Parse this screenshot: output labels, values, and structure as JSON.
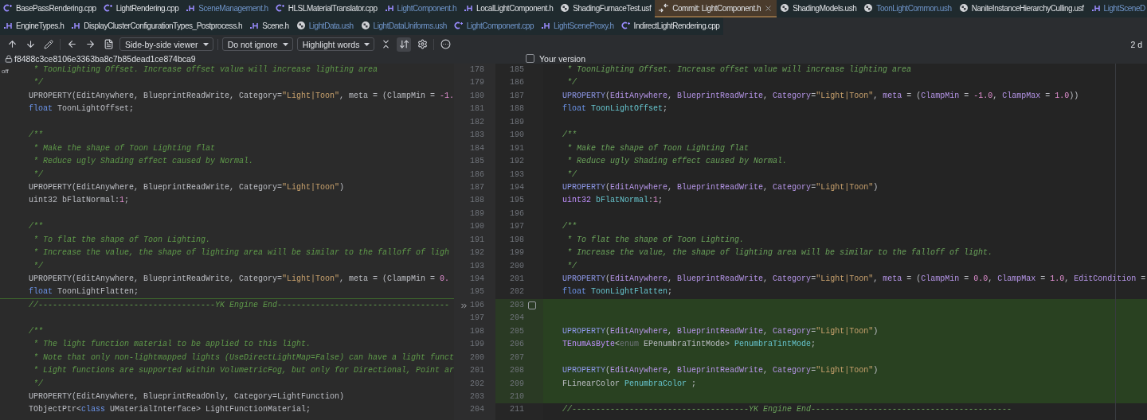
{
  "tab_rows": [
    [
      {
        "label": "BasePassRendering.cpp",
        "kind": "cpp",
        "modified": false,
        "selected": false
      },
      {
        "label": "LightRendering.cpp",
        "kind": "cpp",
        "modified": false,
        "selected": false
      },
      {
        "label": "SceneManagement.h",
        "kind": "h",
        "modified": true,
        "selected": false
      },
      {
        "label": "HLSLMaterialTranslator.cpp",
        "kind": "cpp",
        "modified": false,
        "selected": false
      },
      {
        "label": "LightComponent.h",
        "kind": "h",
        "modified": true,
        "selected": false
      },
      {
        "label": "LocalLightComponent.h",
        "kind": "h",
        "modified": false,
        "selected": false
      },
      {
        "label": "ShadingFurnaceTest.usf",
        "kind": "shader",
        "modified": false,
        "selected": false
      },
      {
        "label": "Commit: LightComponent.h",
        "kind": "commit",
        "modified": false,
        "selected": true
      },
      {
        "label": "ShadingModels.ush",
        "kind": "shader",
        "modified": false,
        "selected": false
      },
      {
        "label": "ToonLightCommon.ush",
        "kind": "shader",
        "modified": true,
        "selected": false
      },
      {
        "label": "NaniteInstanceHierarchyCulling.usf",
        "kind": "shader",
        "modified": false,
        "selected": false
      },
      {
        "label": "LightSceneD",
        "kind": "h",
        "modified": true,
        "selected": false
      }
    ],
    [
      {
        "label": "EngineTypes.h",
        "kind": "h",
        "modified": false,
        "selected": false
      },
      {
        "label": "DisplayClusterConfigurationTypes_Postprocess.h",
        "kind": "h",
        "modified": false,
        "selected": false
      },
      {
        "label": "Scene.h",
        "kind": "h",
        "modified": false,
        "selected": false
      },
      {
        "label": "LightData.ush",
        "kind": "shader",
        "modified": true,
        "selected": false
      },
      {
        "label": "LightDataUniforms.ush",
        "kind": "shader",
        "modified": true,
        "selected": false
      },
      {
        "label": "LightComponent.cpp",
        "kind": "cpp",
        "modified": true,
        "selected": false
      },
      {
        "label": "LightSceneProxy.h",
        "kind": "h",
        "modified": true,
        "selected": false
      },
      {
        "label": "IndirectLightRendering.cpp",
        "kind": "cpp",
        "modified": false,
        "selected": false
      }
    ]
  ],
  "toolbar": {
    "viewer": "Side-by-side viewer",
    "ignore": "Do not ignore",
    "highlight": "Highlight words",
    "sync_scroll": {
      "selected": true
    },
    "differences": "2 d"
  },
  "revision": "f8488c3ce8106e3363ba8c7b85dead1ce874bca9",
  "your_version": {
    "label": "Your version",
    "checked": false
  },
  "gutter_note": "off",
  "rows": [
    {
      "left_num": "178",
      "right_num": "185",
      "added": false,
      "left": [
        {
          "text": " * ToonLighting Offset. Increase offset value will increase lighting area",
          "kind": "comment"
        }
      ],
      "right": [
        {
          "text": " * ToonLighting Offset. Increase offset value will increase lighting area",
          "kind": "comment"
        }
      ]
    },
    {
      "left_num": "179",
      "right_num": "186",
      "added": false,
      "left": [
        {
          "text": " */",
          "kind": "comment"
        }
      ],
      "right": [
        {
          "text": " */",
          "kind": "comment"
        }
      ]
    },
    {
      "left_num": "180",
      "right_num": "187",
      "added": false,
      "left": [
        {
          "text": "UPROPERTY(EditAnywhere, BlueprintReadWrite, Category=",
          "kind": "plain"
        },
        {
          "text": "\"Light|Toon\"",
          "kind": "string"
        },
        {
          "text": ", meta = (ClampMin = ",
          "kind": "plain"
        },
        {
          "text": "-1.",
          "kind": "number"
        }
      ],
      "right": [
        {
          "text": "UPROPERTY",
          "kind": "macro"
        },
        {
          "text": "(",
          "kind": "plain"
        },
        {
          "text": "EditAnywhere",
          "kind": "attribute"
        },
        {
          "text": ", ",
          "kind": "plain"
        },
        {
          "text": "BlueprintReadWrite",
          "kind": "attribute"
        },
        {
          "text": ", ",
          "kind": "plain"
        },
        {
          "text": "Category",
          "kind": "attribute"
        },
        {
          "text": "=",
          "kind": "plain"
        },
        {
          "text": "\"Light|Toon\"",
          "kind": "string"
        },
        {
          "text": ", ",
          "kind": "plain"
        },
        {
          "text": "meta",
          "kind": "attribute"
        },
        {
          "text": " = (",
          "kind": "plain"
        },
        {
          "text": "ClampMin",
          "kind": "attribute"
        },
        {
          "text": " = ",
          "kind": "plain"
        },
        {
          "text": "-1.0",
          "kind": "number"
        },
        {
          "text": ", ",
          "kind": "plain"
        },
        {
          "text": "ClampMax",
          "kind": "attribute"
        },
        {
          "text": " = ",
          "kind": "plain"
        },
        {
          "text": "1.0",
          "kind": "number"
        },
        {
          "text": "))",
          "kind": "plain"
        }
      ]
    },
    {
      "left_num": "181",
      "right_num": "188",
      "added": false,
      "left": [
        {
          "text": "float ",
          "kind": "keyword"
        },
        {
          "text": "ToonLightOffset;",
          "kind": "plain"
        }
      ],
      "right": [
        {
          "text": "float ",
          "kind": "keyword"
        },
        {
          "text": "ToonLightOffset",
          "kind": "field"
        },
        {
          "text": ";",
          "kind": "plain"
        }
      ]
    },
    {
      "left_num": "182",
      "right_num": "189",
      "added": false,
      "left": [],
      "right": []
    },
    {
      "left_num": "183",
      "right_num": "190",
      "added": false,
      "left": [
        {
          "text": "/**",
          "kind": "comment"
        }
      ],
      "right": [
        {
          "text": "/**",
          "kind": "comment"
        }
      ]
    },
    {
      "left_num": "184",
      "right_num": "191",
      "added": false,
      "left": [
        {
          "text": " * Make the shape of Toon Lighting flat",
          "kind": "comment"
        }
      ],
      "right": [
        {
          "text": " * Make the shape of Toon Lighting flat",
          "kind": "comment"
        }
      ]
    },
    {
      "left_num": "185",
      "right_num": "192",
      "added": false,
      "left": [
        {
          "text": " * Reduce ugly Shading effect caused by Normal.",
          "kind": "comment"
        }
      ],
      "right": [
        {
          "text": " * Reduce ugly Shading effect caused by Normal.",
          "kind": "comment"
        }
      ]
    },
    {
      "left_num": "186",
      "right_num": "193",
      "added": false,
      "left": [
        {
          "text": " */",
          "kind": "comment"
        }
      ],
      "right": [
        {
          "text": " */",
          "kind": "comment"
        }
      ]
    },
    {
      "left_num": "187",
      "right_num": "194",
      "added": false,
      "left": [
        {
          "text": "UPROPERTY(EditAnywhere, BlueprintReadWrite, Category=",
          "kind": "plain"
        },
        {
          "text": "\"Light|Toon\"",
          "kind": "string"
        },
        {
          "text": ")",
          "kind": "plain"
        }
      ],
      "right": [
        {
          "text": "UPROPERTY",
          "kind": "macro"
        },
        {
          "text": "(",
          "kind": "plain"
        },
        {
          "text": "EditAnywhere",
          "kind": "attribute"
        },
        {
          "text": ", ",
          "kind": "plain"
        },
        {
          "text": "BlueprintReadWrite",
          "kind": "attribute"
        },
        {
          "text": ", ",
          "kind": "plain"
        },
        {
          "text": "Category",
          "kind": "attribute"
        },
        {
          "text": "=",
          "kind": "plain"
        },
        {
          "text": "\"Light|Toon\"",
          "kind": "string"
        },
        {
          "text": ")",
          "kind": "plain"
        }
      ]
    },
    {
      "left_num": "188",
      "right_num": "195",
      "added": false,
      "left": [
        {
          "text": "uint32 bFlatNormal:",
          "kind": "plain"
        },
        {
          "text": "1",
          "kind": "number"
        },
        {
          "text": ";",
          "kind": "plain"
        }
      ],
      "right": [
        {
          "text": "uint32 ",
          "kind": "type"
        },
        {
          "text": "bFlatNormal",
          "kind": "field"
        },
        {
          "text": ":",
          "kind": "plain"
        },
        {
          "text": "1",
          "kind": "number"
        },
        {
          "text": ";",
          "kind": "plain"
        }
      ]
    },
    {
      "left_num": "189",
      "right_num": "196",
      "added": false,
      "left": [],
      "right": []
    },
    {
      "left_num": "190",
      "right_num": "197",
      "added": false,
      "left": [
        {
          "text": "/**",
          "kind": "comment"
        }
      ],
      "right": [
        {
          "text": "/**",
          "kind": "comment"
        }
      ]
    },
    {
      "left_num": "191",
      "right_num": "198",
      "added": false,
      "left": [
        {
          "text": " * To flat the shape of Toon Lighting.",
          "kind": "comment"
        }
      ],
      "right": [
        {
          "text": " * To flat the shape of Toon Lighting.",
          "kind": "comment"
        }
      ]
    },
    {
      "left_num": "192",
      "right_num": "199",
      "added": false,
      "left": [
        {
          "text": " * Increase the value, the shape of lighting area will be similar to the falloff of ligh",
          "kind": "comment"
        }
      ],
      "right": [
        {
          "text": " * Increase the value, the shape of lighting area will be similar to the falloff of light.",
          "kind": "comment"
        }
      ]
    },
    {
      "left_num": "193",
      "right_num": "200",
      "added": false,
      "left": [
        {
          "text": " */",
          "kind": "comment"
        }
      ],
      "right": [
        {
          "text": " */",
          "kind": "comment"
        }
      ]
    },
    {
      "left_num": "194",
      "right_num": "201",
      "added": false,
      "left": [
        {
          "text": "UPROPERTY(EditAnywhere, BlueprintReadWrite, Category=",
          "kind": "plain"
        },
        {
          "text": "\"Light|Toon\"",
          "kind": "string"
        },
        {
          "text": ", meta = (ClampMin = ",
          "kind": "plain"
        },
        {
          "text": "0.",
          "kind": "number"
        }
      ],
      "right": [
        {
          "text": "UPROPERTY",
          "kind": "macro"
        },
        {
          "text": "(",
          "kind": "plain"
        },
        {
          "text": "EditAnywhere",
          "kind": "attribute"
        },
        {
          "text": ", ",
          "kind": "plain"
        },
        {
          "text": "BlueprintReadWrite",
          "kind": "attribute"
        },
        {
          "text": ", ",
          "kind": "plain"
        },
        {
          "text": "Category",
          "kind": "attribute"
        },
        {
          "text": "=",
          "kind": "plain"
        },
        {
          "text": "\"Light|Toon\"",
          "kind": "string"
        },
        {
          "text": ", ",
          "kind": "plain"
        },
        {
          "text": "meta",
          "kind": "attribute"
        },
        {
          "text": " = (",
          "kind": "plain"
        },
        {
          "text": "ClampMin",
          "kind": "attribute"
        },
        {
          "text": " = ",
          "kind": "plain"
        },
        {
          "text": "0.0",
          "kind": "number"
        },
        {
          "text": ", ",
          "kind": "plain"
        },
        {
          "text": "ClampMax",
          "kind": "attribute"
        },
        {
          "text": " = ",
          "kind": "plain"
        },
        {
          "text": "1.0",
          "kind": "number"
        },
        {
          "text": ", ",
          "kind": "plain"
        },
        {
          "text": "EditCondition",
          "kind": "attribute"
        },
        {
          "text": " =",
          "kind": "plain"
        }
      ]
    },
    {
      "left_num": "195",
      "right_num": "202",
      "added": false,
      "left": [
        {
          "text": "float ",
          "kind": "keyword"
        },
        {
          "text": "ToonLightFlatten;",
          "kind": "plain"
        }
      ],
      "right": [
        {
          "text": "float ",
          "kind": "keyword"
        },
        {
          "text": "ToonLightFlatten",
          "kind": "field"
        },
        {
          "text": ";",
          "kind": "plain"
        }
      ]
    },
    {
      "left_num": "196",
      "right_num": "203",
      "added": true,
      "change": {
        "checked": false
      },
      "left": [
        {
          "text": "//-------------------------------------YK Engine End------------------------------------",
          "kind": "comment"
        }
      ],
      "right": []
    },
    {
      "left_num": "197",
      "right_num": "204",
      "added": true,
      "left": [],
      "right": []
    },
    {
      "left_num": "198",
      "right_num": "205",
      "added": true,
      "left": [
        {
          "text": "/**",
          "kind": "comment"
        }
      ],
      "right": [
        {
          "text": "UPROPERTY",
          "kind": "macro"
        },
        {
          "text": "(",
          "kind": "plain"
        },
        {
          "text": "EditAnywhere",
          "kind": "attribute"
        },
        {
          "text": ", ",
          "kind": "plain"
        },
        {
          "text": "BlueprintReadWrite",
          "kind": "attribute"
        },
        {
          "text": ", ",
          "kind": "plain"
        },
        {
          "text": "Category",
          "kind": "attribute"
        },
        {
          "text": "=",
          "kind": "plain"
        },
        {
          "text": "\"Light|Toon\"",
          "kind": "string"
        },
        {
          "text": ")",
          "kind": "plain"
        }
      ]
    },
    {
      "left_num": "199",
      "right_num": "206",
      "added": true,
      "left": [
        {
          "text": " * The light function material to be applied to this light.",
          "kind": "comment"
        }
      ],
      "right": [
        {
          "text": "TEnumAsByte",
          "kind": "type"
        },
        {
          "text": "<",
          "kind": "plain"
        },
        {
          "text": "enum",
          "kind": "muted"
        },
        {
          "text": " EPenumbraTintMode> ",
          "kind": "plain"
        },
        {
          "text": "PenumbraTintMode",
          "kind": "field"
        },
        {
          "text": ";",
          "kind": "plain"
        }
      ]
    },
    {
      "left_num": "200",
      "right_num": "207",
      "added": true,
      "left": [
        {
          "text": " * Note that only non-lightmapped lights (UseDirectLightMap=False) can have a light funct",
          "kind": "comment"
        }
      ],
      "right": []
    },
    {
      "left_num": "201",
      "right_num": "208",
      "added": true,
      "left": [
        {
          "text": " * Light functions are supported within VolumetricFog, but only for Directional, Point ar",
          "kind": "comment"
        }
      ],
      "right": [
        {
          "text": "UPROPERTY",
          "kind": "macro"
        },
        {
          "text": "(",
          "kind": "plain"
        },
        {
          "text": "EditAnywhere",
          "kind": "attribute"
        },
        {
          "text": ", ",
          "kind": "plain"
        },
        {
          "text": "BlueprintReadWrite",
          "kind": "attribute"
        },
        {
          "text": ", ",
          "kind": "plain"
        },
        {
          "text": "Category",
          "kind": "attribute"
        },
        {
          "text": "=",
          "kind": "plain"
        },
        {
          "text": "\"Light|Toon\"",
          "kind": "string"
        },
        {
          "text": ")",
          "kind": "plain"
        }
      ]
    },
    {
      "left_num": "202",
      "right_num": "209",
      "added": true,
      "left": [
        {
          "text": " */",
          "kind": "comment"
        }
      ],
      "right": [
        {
          "text": "FLinearColor ",
          "kind": "plain"
        },
        {
          "text": "PenumbraColor",
          "kind": "field"
        },
        {
          "text": " ;",
          "kind": "plain"
        }
      ]
    },
    {
      "left_num": "203",
      "right_num": "210",
      "added": true,
      "left": [
        {
          "text": "UPROPERTY(EditAnywhere, BlueprintReadOnly, Category=LightFunction)",
          "kind": "plain"
        }
      ],
      "right": []
    },
    {
      "left_num": "204",
      "right_num": "211",
      "added": false,
      "left": [
        {
          "text": "TObjectPtr<",
          "kind": "plain"
        },
        {
          "text": "class",
          "kind": "keyword"
        },
        {
          "text": " UMaterialInterface> LightFunctionMaterial;",
          "kind": "plain"
        }
      ],
      "right": [
        {
          "text": "//-------------------------------------YK Engine End------------------------------------------",
          "kind": "comment"
        }
      ]
    }
  ]
}
